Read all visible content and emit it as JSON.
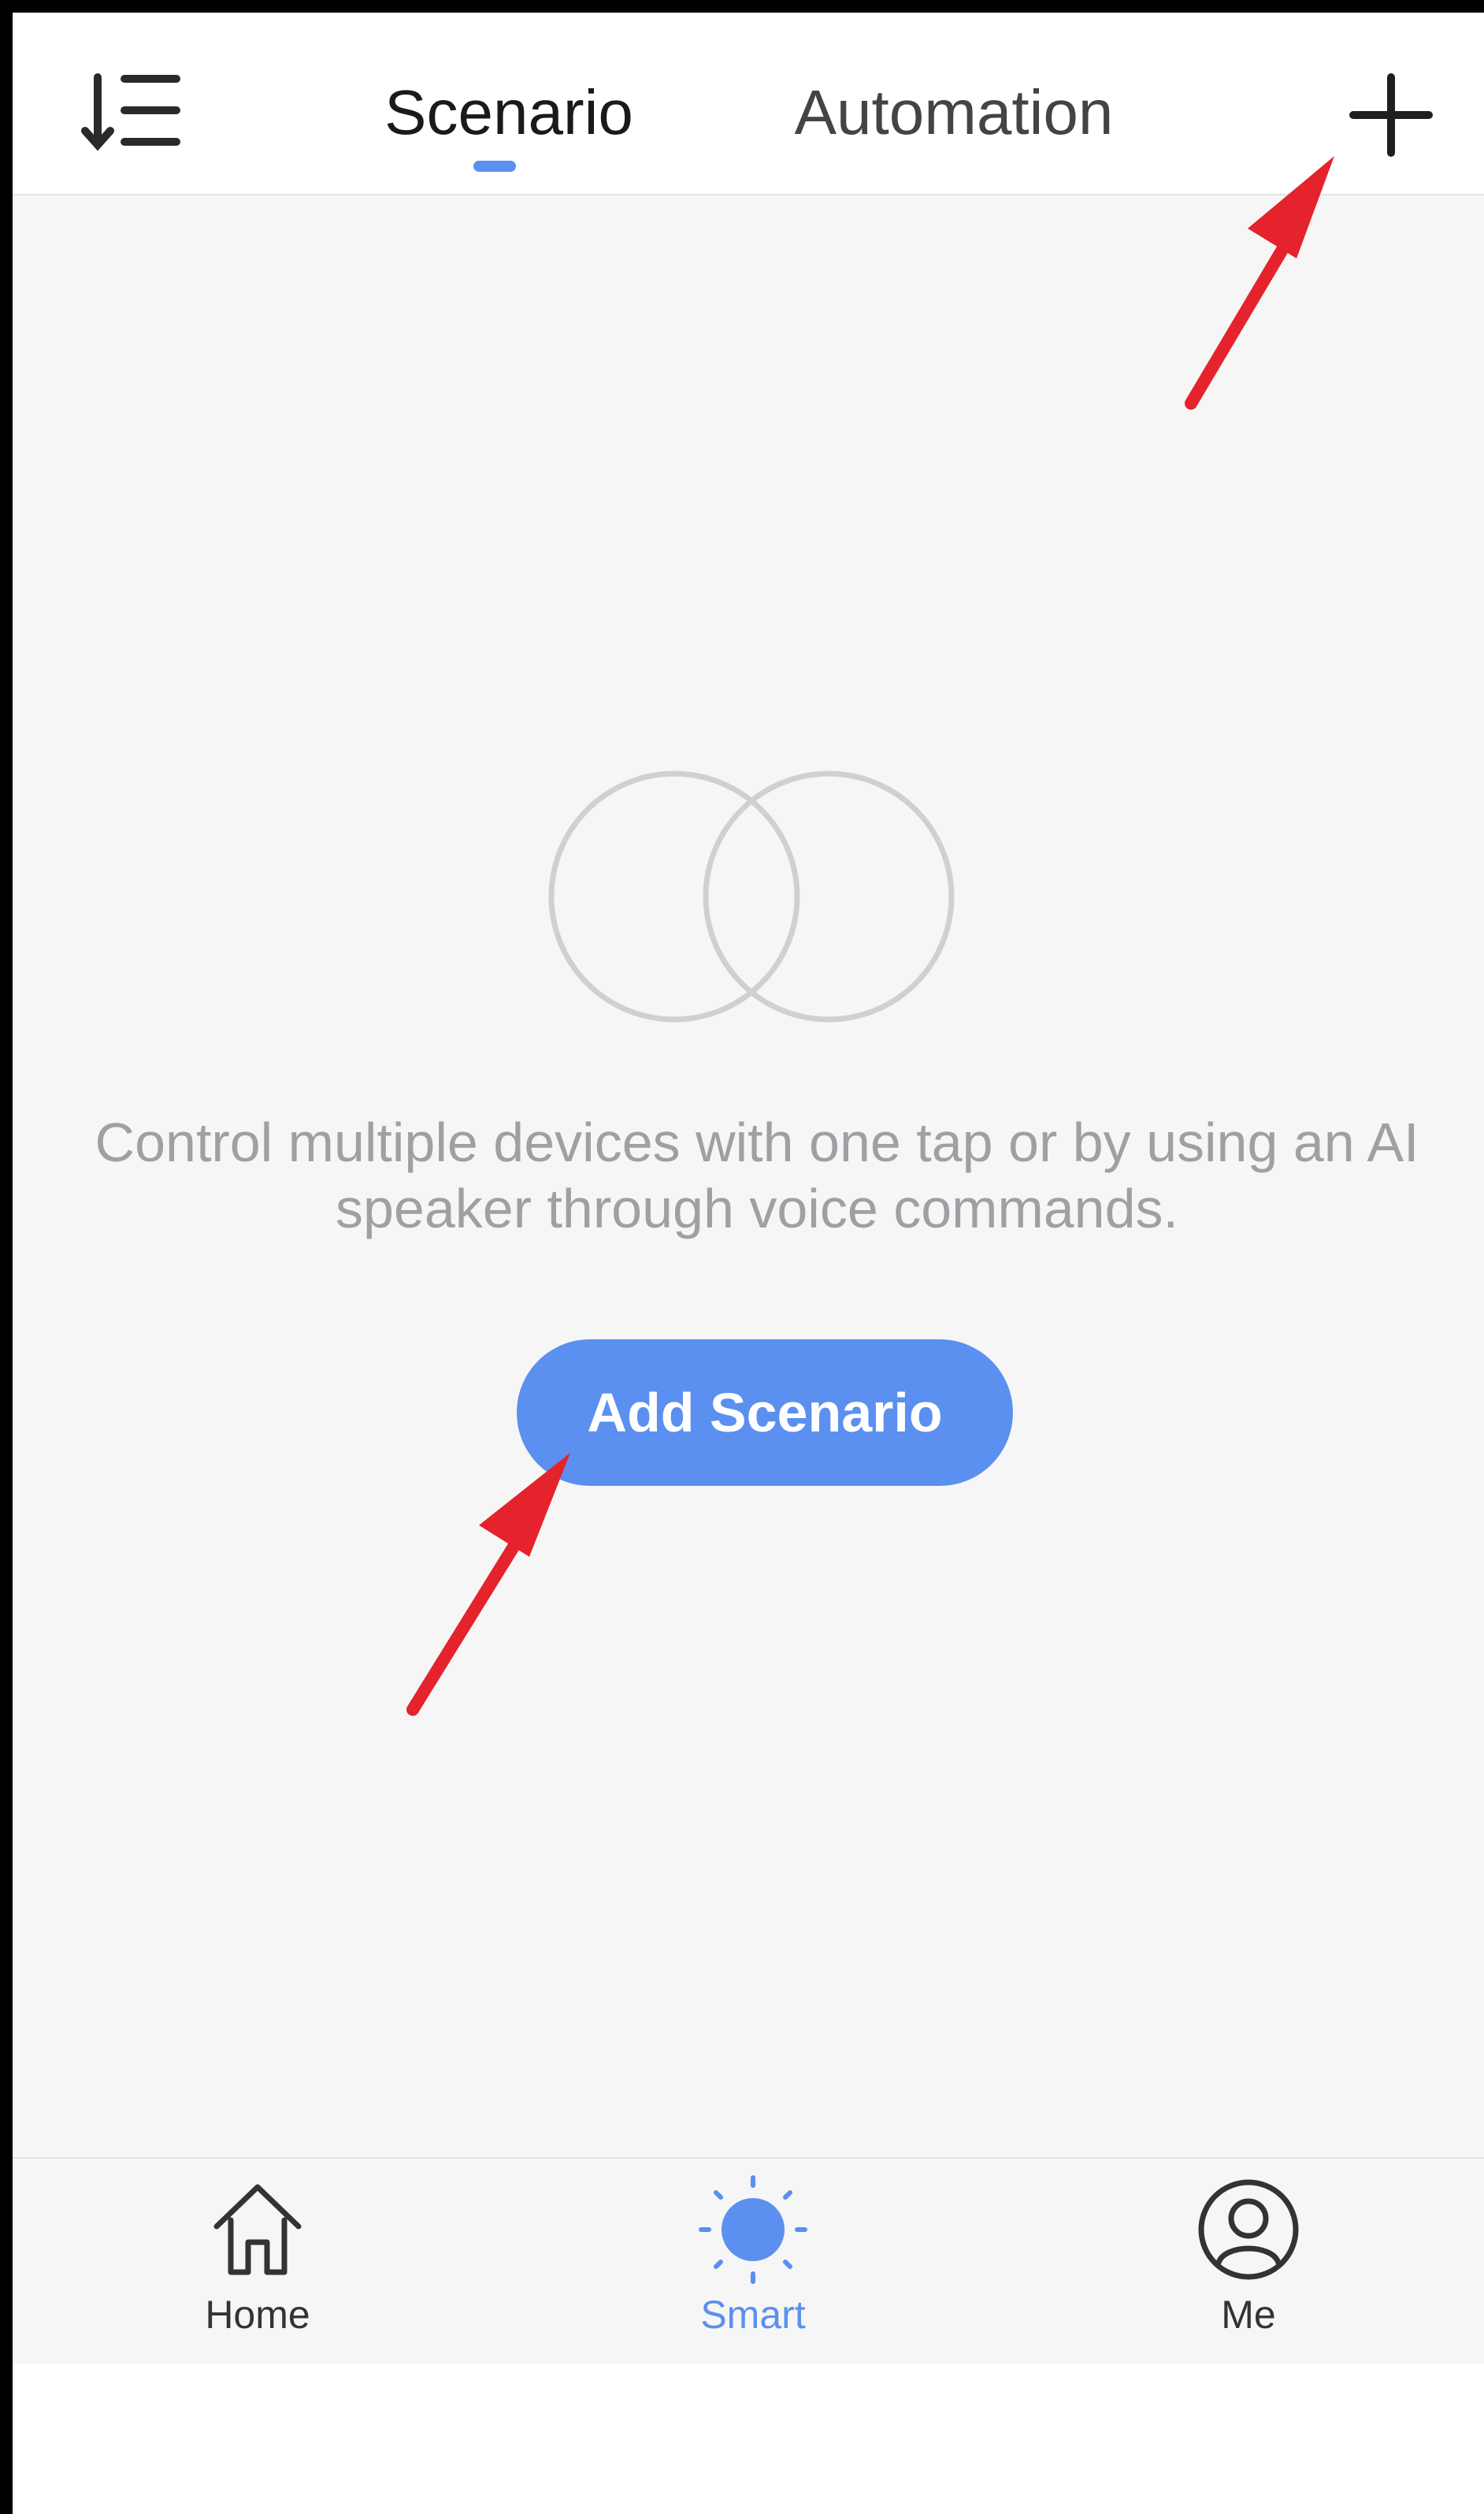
{
  "header": {
    "tabs": [
      {
        "label": "Scenario",
        "active": true
      },
      {
        "label": "Automation",
        "active": false
      }
    ],
    "sort_icon": "sort-list-icon",
    "add_icon": "plus-icon"
  },
  "empty_state": {
    "icon": "overlapping-circles-icon",
    "message": "Control multiple devices with one tap or by using an AI speaker through voice commands.",
    "button_label": "Add Scenario"
  },
  "bottom_nav": {
    "items": [
      {
        "label": "Home",
        "icon": "home-icon",
        "active": false
      },
      {
        "label": "Smart",
        "icon": "sun-icon",
        "active": true
      },
      {
        "label": "Me",
        "icon": "profile-icon",
        "active": false
      }
    ]
  },
  "annotations": {
    "arrow_color": "#e5232c"
  },
  "colors": {
    "accent": "#5b8ff0",
    "background": "#f6f6f6",
    "text_muted": "#9ea0a4"
  }
}
